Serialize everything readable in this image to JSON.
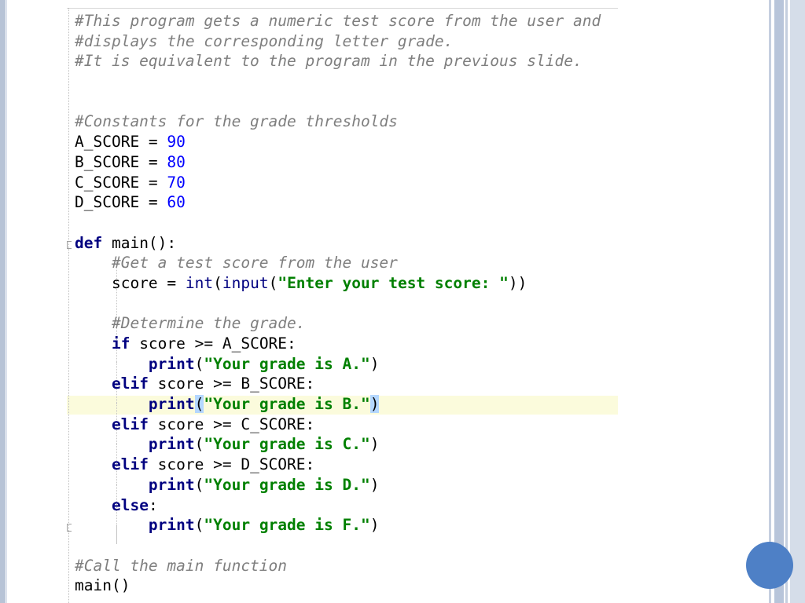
{
  "editor": {
    "lines": [
      [
        {
          "t": "c",
          "v": "#This program gets a numeric test score from the user and"
        }
      ],
      [
        {
          "t": "c",
          "v": "#displays the corresponding letter grade."
        }
      ],
      [
        {
          "t": "c",
          "v": "#It is equivalent to the program in the previous slide."
        }
      ],
      [],
      [],
      [
        {
          "t": "c",
          "v": "#Constants for the grade thresholds"
        }
      ],
      [
        {
          "t": "p",
          "v": "A_SCORE = "
        },
        {
          "t": "n",
          "v": "90"
        }
      ],
      [
        {
          "t": "p",
          "v": "B_SCORE = "
        },
        {
          "t": "n",
          "v": "80"
        }
      ],
      [
        {
          "t": "p",
          "v": "C_SCORE = "
        },
        {
          "t": "n",
          "v": "70"
        }
      ],
      [
        {
          "t": "p",
          "v": "D_SCORE = "
        },
        {
          "t": "n",
          "v": "60"
        }
      ],
      [],
      [
        {
          "t": "k",
          "v": "def"
        },
        {
          "t": "p",
          "v": " main():"
        }
      ],
      [
        {
          "t": "p",
          "v": "    "
        },
        {
          "t": "c",
          "v": "#Get a test score from the user"
        }
      ],
      [
        {
          "t": "p",
          "v": "    score = "
        },
        {
          "t": "b",
          "v": "int"
        },
        {
          "t": "p",
          "v": "("
        },
        {
          "t": "b",
          "v": "input"
        },
        {
          "t": "p",
          "v": "("
        },
        {
          "t": "s",
          "v": "\"Enter your test score: \""
        },
        {
          "t": "p",
          "v": "))"
        }
      ],
      [],
      [
        {
          "t": "p",
          "v": "    "
        },
        {
          "t": "c",
          "v": "#Determine the grade."
        }
      ],
      [
        {
          "t": "p",
          "v": "    "
        },
        {
          "t": "k",
          "v": "if"
        },
        {
          "t": "p",
          "v": " score >= A_SCORE:"
        }
      ],
      [
        {
          "t": "p",
          "v": "        "
        },
        {
          "t": "k",
          "v": "print"
        },
        {
          "t": "p",
          "v": "("
        },
        {
          "t": "s",
          "v": "\"Your grade is A.\""
        },
        {
          "t": "p",
          "v": ")"
        }
      ],
      [
        {
          "t": "p",
          "v": "    "
        },
        {
          "t": "k",
          "v": "elif"
        },
        {
          "t": "p",
          "v": " score >= B_SCORE:"
        }
      ],
      [
        {
          "t": "p",
          "v": "        "
        },
        {
          "t": "k",
          "v": "print"
        },
        {
          "t": "m",
          "v": "("
        },
        {
          "t": "s",
          "v": "\"Your grade is B.\""
        },
        {
          "t": "m",
          "v": ")"
        }
      ],
      [
        {
          "t": "p",
          "v": "    "
        },
        {
          "t": "k",
          "v": "elif"
        },
        {
          "t": "p",
          "v": " score >= C_SCORE:"
        }
      ],
      [
        {
          "t": "p",
          "v": "        "
        },
        {
          "t": "k",
          "v": "print"
        },
        {
          "t": "p",
          "v": "("
        },
        {
          "t": "s",
          "v": "\"Your grade is C.\""
        },
        {
          "t": "p",
          "v": ")"
        }
      ],
      [
        {
          "t": "p",
          "v": "    "
        },
        {
          "t": "k",
          "v": "elif"
        },
        {
          "t": "p",
          "v": " score >= D_SCORE:"
        }
      ],
      [
        {
          "t": "p",
          "v": "        "
        },
        {
          "t": "k",
          "v": "print"
        },
        {
          "t": "p",
          "v": "("
        },
        {
          "t": "s",
          "v": "\"Your grade is D.\""
        },
        {
          "t": "p",
          "v": ")"
        }
      ],
      [
        {
          "t": "p",
          "v": "    "
        },
        {
          "t": "k",
          "v": "else"
        },
        {
          "t": "p",
          "v": ":"
        }
      ],
      [
        {
          "t": "p",
          "v": "        "
        },
        {
          "t": "k",
          "v": "print"
        },
        {
          "t": "p",
          "v": "("
        },
        {
          "t": "s",
          "v": "\"Your grade is F.\""
        },
        {
          "t": "p",
          "v": ")"
        }
      ],
      [],
      [
        {
          "t": "c",
          "v": "#Call the main function"
        }
      ],
      [
        {
          "t": "p",
          "v": "main()"
        }
      ]
    ],
    "highlighted_line": 20
  },
  "colors": {
    "comment": "#7f7f7f",
    "keyword": "#000080",
    "number": "#0000ff",
    "string": "#008000",
    "line_highlight": "#fbfbdc",
    "bracket_match": "#b4d7ff",
    "slide_dot": "#4e80c6"
  }
}
